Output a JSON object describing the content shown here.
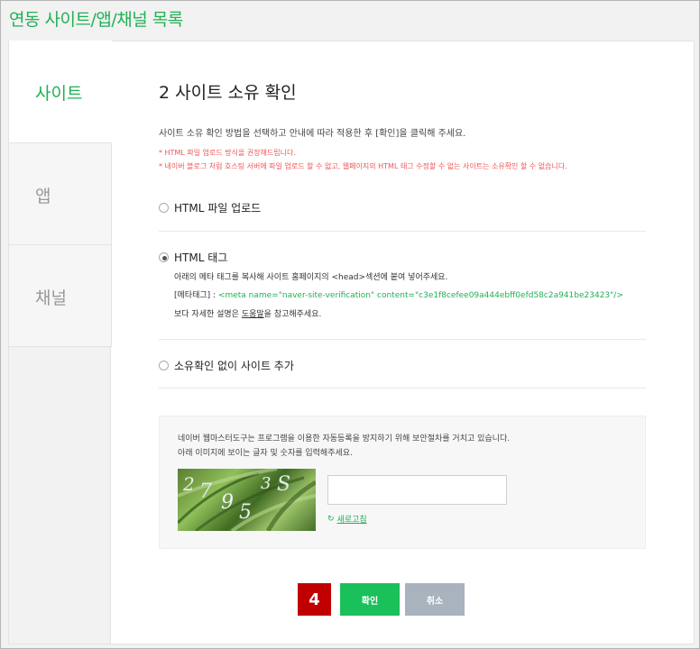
{
  "page": {
    "title": "연동 사이트/앱/채널 목록"
  },
  "sidebar": {
    "tabs": [
      {
        "label": "사이트"
      },
      {
        "label": "앱"
      },
      {
        "label": "채널"
      }
    ]
  },
  "main": {
    "step_title": "2 사이트 소유 확인",
    "description": "사이트 소유 확인 방법을 선택하고 안내에 따라 적용한 후 [확인]을 클릭해 주세요.",
    "warnings": [
      "* HTML 파일 업로드 방식을 권장해드립니다.",
      "* 네이버 블로그 처럼 호스팅 서버에 파일 업로드 할 수 없고, 웹페이지의 HTML 태그 수정할 수 없는 사이트는 소유확인 할 수 없습니다."
    ],
    "options": {
      "html_file": {
        "label": "HTML 파일 업로드",
        "checked": false
      },
      "html_tag": {
        "label": "HTML 태그",
        "checked": true,
        "instruction": "아래의 메타 태그를 복사해 사이트 홈페이지의 <head>섹션에 붙여 넣어주세요.",
        "meta_prefix": "[메타태그] : ",
        "meta_tag": "<meta name=\"naver-site-verification\" content=\"c3e1f8cefee09a444ebff0efd58c2a941be23423\"/>",
        "help_before": "보다 자세한 설명은 ",
        "help_link": "도움말",
        "help_after": "을 참고해주세요."
      },
      "no_verify": {
        "label": "소유확인 없이 사이트 추가",
        "checked": false
      }
    },
    "captcha": {
      "text_line1": "네이버 웹마스터도구는 프로그램을 이용한 자동등록을 방지하기 위해 보안절차를 거치고 있습니다.",
      "text_line2": "아래 이미지에 보이는 글자 및 숫자를 입력해주세요.",
      "image_text": "2795 3S",
      "input_value": "",
      "refresh_label": "새로고침"
    },
    "buttons": {
      "confirm": "확인",
      "cancel": "취소"
    },
    "step_badge": "4"
  },
  "colors": {
    "accent": "#1fb154",
    "warning": "#f05555",
    "badge": "#c00000",
    "cancel": "#a8b3bd"
  }
}
